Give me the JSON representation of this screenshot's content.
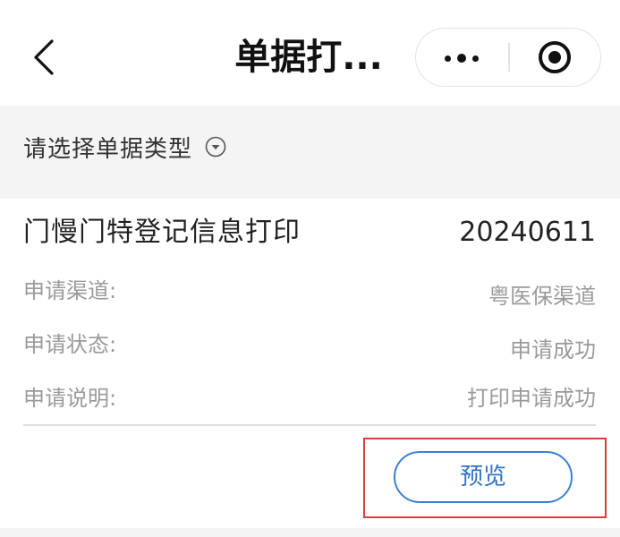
{
  "navbar": {
    "title": "单据打...",
    "back_icon": "chevron-left-icon",
    "more_icon": "more-dots-icon",
    "close_icon": "target-close-icon"
  },
  "selector": {
    "label": "请选择单据类型",
    "arrow_icon": "chevron-down-circle-icon"
  },
  "record": {
    "title": "门慢门特登记信息打印",
    "date": "20240611",
    "rows": [
      {
        "label": "申请渠道:",
        "value": "粤医保渠道"
      },
      {
        "label": "申请状态:",
        "value": "申请成功"
      },
      {
        "label": "申请说明:",
        "value": "打印申请成功"
      }
    ],
    "preview_label": "预览"
  },
  "colors": {
    "accent": "#2f74c5",
    "highlight": "#e03a3a",
    "band": "#f4f4f4"
  }
}
